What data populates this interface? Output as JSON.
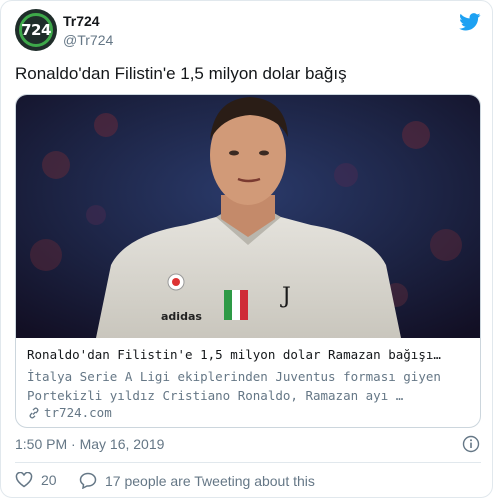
{
  "author": {
    "name": "Tr724",
    "handle": "@Tr724",
    "avatar_text": "724"
  },
  "tweet": {
    "text": "Ronaldo'dan Filistin'e 1,5 milyon dolar bağış"
  },
  "card": {
    "title": "Ronaldo'dan Filistin'e 1,5 milyon dolar Ramazan bağışı…",
    "description_line1": "İtalya Serie A Ligi ekiplerinden Juventus forması giyen",
    "description_line2": "Portekizli yıldız Cristiano Ronaldo, Ramazan ayı …",
    "domain": "tr724.com",
    "image_alt_text": "adidas"
  },
  "meta": {
    "timestamp": "1:50 PM · May 16, 2019"
  },
  "actions": {
    "like_count": "20",
    "conversation_text": "17 people are Tweeting about this"
  },
  "colors": {
    "twitter_blue": "#1da1f2",
    "text_primary": "#14171a",
    "text_secondary": "#657786",
    "border": "#e1e8ed",
    "background_image": "#1b2140"
  },
  "icons": {
    "brand": "twitter-bird-icon",
    "info": "info-icon",
    "like": "heart-icon",
    "reply": "speech-bubble-icon",
    "link": "link-chain-icon"
  }
}
